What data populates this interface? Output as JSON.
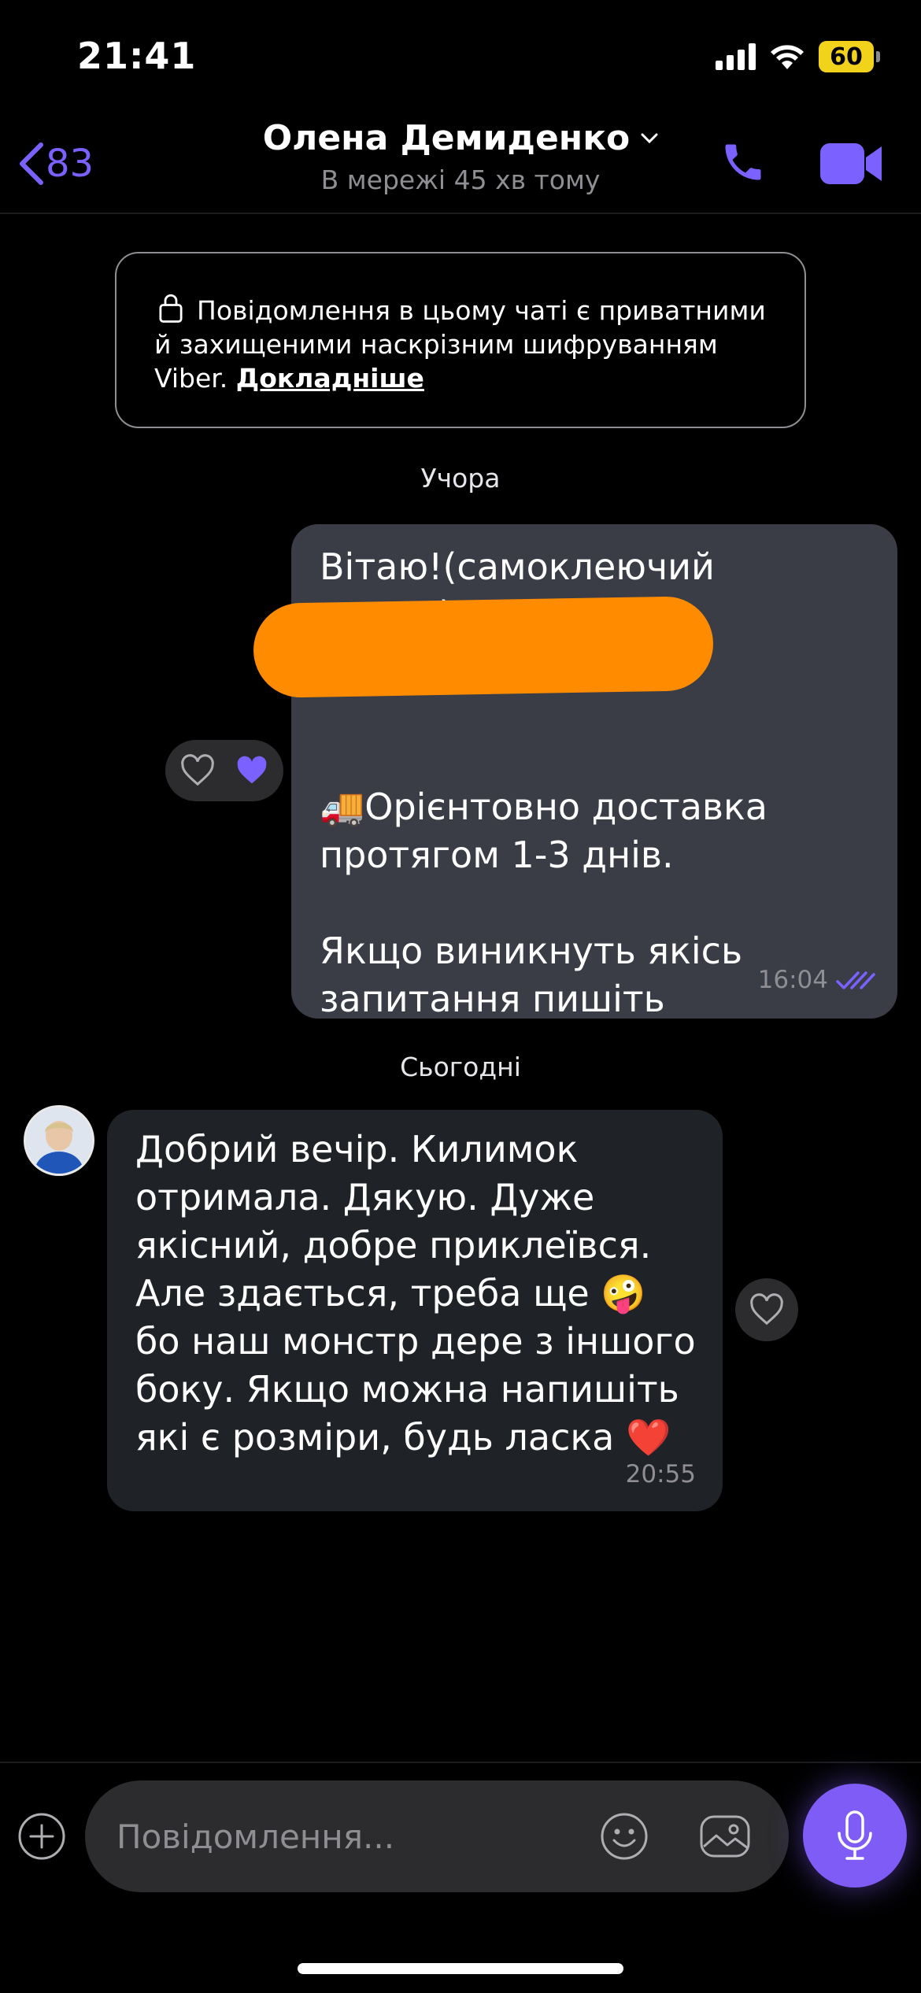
{
  "status_bar": {
    "time": "21:41",
    "battery": "60"
  },
  "header": {
    "back_count": "83",
    "contact_name": "Олена Демиденко",
    "contact_status": "В мережі 45 хв тому"
  },
  "e2e_notice": {
    "text": "Повідомлення в цьому чаті є приватними й захищеними наскрізним шифруванням Viber.",
    "link": "Докладніше"
  },
  "dates": {
    "yesterday": "Учора",
    "today": "Сьогодні"
  },
  "messages": [
    {
      "direction": "outgoing",
      "text": "Вітаю!(самоклеючий килим).\nВаше від...\n\n\n🚚Орієнтовно доставка протягом 1-3 днів.\n\nЯкщо виникнуть якісь запитання пишіть",
      "time": "16:04",
      "reactions": [
        "heart-outline",
        "heart-filled"
      ]
    },
    {
      "direction": "incoming",
      "text": "Добрий вечір. Килимок отримала. Дякую. Дуже якісний, добре приклеївся. Але здається, треба ще 🤪 бо наш монстр дере з іншого боку. Якщо можна напишіть які є розміри, будь ласка ❤️",
      "time": "20:55"
    }
  ],
  "composer": {
    "placeholder": "Повідомлення..."
  },
  "colors": {
    "accent": "#7b61ff",
    "outgoing_bubble": "#3a3d46",
    "incoming_bubble": "#1f2226",
    "redaction": "#ff8c00"
  }
}
